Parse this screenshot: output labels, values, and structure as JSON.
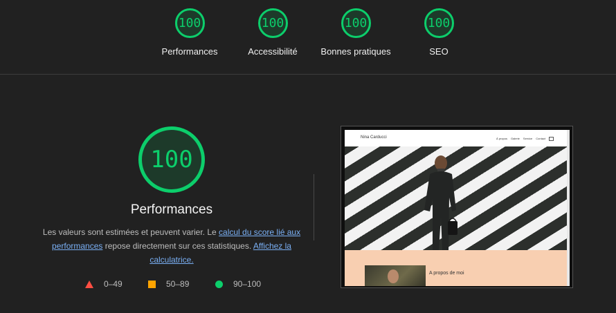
{
  "top_scores": [
    {
      "score": "100",
      "label": "Performances"
    },
    {
      "score": "100",
      "label": "Accessibilité"
    },
    {
      "score": "100",
      "label": "Bonnes pratiques"
    },
    {
      "score": "100",
      "label": "SEO"
    }
  ],
  "main": {
    "score": "100",
    "title": "Performances",
    "desc_part1": "Les valeurs sont estimées et peuvent varier. Le ",
    "desc_link1": "calcul du score lié aux performances",
    "desc_part2": " repose directement sur ces statistiques. ",
    "desc_link2": "Affichez la calculatrice."
  },
  "legend": [
    {
      "range": "0–49",
      "color": "#ff4e42",
      "icon": "triangle-icon"
    },
    {
      "range": "50–89",
      "color": "#ffa400",
      "icon": "square-icon"
    },
    {
      "range": "90–100",
      "color": "#0cce6b",
      "icon": "circle-icon"
    }
  ],
  "thumbnail": {
    "brand": "Nina Carducci",
    "nav": [
      "À propos",
      "Galerie",
      "Service",
      "Contact"
    ],
    "about_title": "A propos de moi"
  },
  "colors": {
    "pass": "#0cce6b",
    "background": "#212121"
  }
}
